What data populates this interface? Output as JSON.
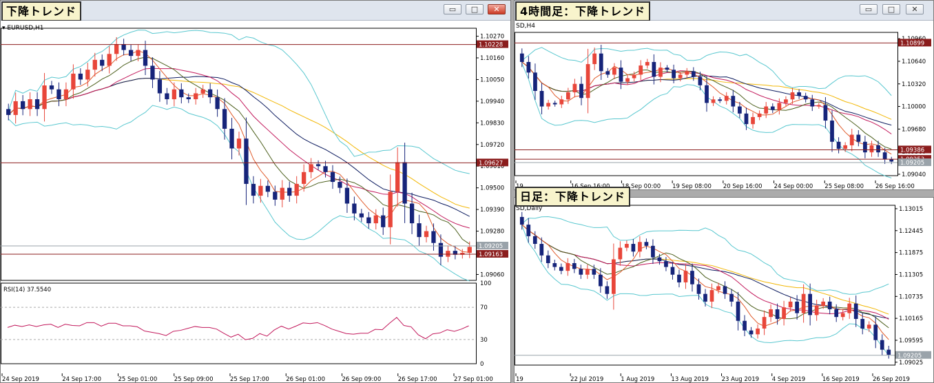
{
  "windows": {
    "h1": {
      "title": "下降トレンド",
      "symbol_label": "EURUSD,H1",
      "rsi_label": "RSI(14) 37.5540",
      "price_ticks": [
        "1.10270",
        "1.10160",
        "1.10050",
        "1.09940",
        "1.09830",
        "1.09720",
        "1.09610",
        "1.09500",
        "1.09390",
        "1.09280",
        "1.09170",
        "1.09060"
      ],
      "hlines": [
        {
          "label": "1.10228",
          "value": 1.10228,
          "color": "#8b1d1d"
        },
        {
          "label": "1.09627",
          "value": 1.09627,
          "color": "#8b1d1d"
        },
        {
          "label": "1.09163",
          "value": 1.09163,
          "color": "#8b1d1d"
        },
        {
          "label": "1.09205",
          "value": 1.09205,
          "color": "#9aa3aa"
        }
      ],
      "x_labels": [
        "24 Sep 2019",
        "24 Sep 17:00",
        "25 Sep 01:00",
        "25 Sep 09:00",
        "25 Sep 17:00",
        "26 Sep 01:00",
        "26 Sep 09:00",
        "26 Sep 17:00",
        "27 Sep 01:00"
      ],
      "rsi_ticks": [
        "100",
        "70",
        "30",
        "0"
      ],
      "chart_data": {
        "type": "candlestick",
        "ylim": [
          1.0903,
          1.103
        ],
        "series": [
          {
            "name": "close",
            "values": [
              1.0987,
              1.0994,
              1.099,
              1.0995,
              1.099,
              1.1002,
              1.1,
              1.0995,
              1.1,
              1.1008,
              1.1005,
              1.101,
              1.1015,
              1.1012,
              1.1018,
              1.1023,
              1.102,
              1.1017,
              1.102,
              1.1012,
              1.1005,
              1.0998,
              1.0995,
              1.1,
              1.0996,
              1.0995,
              1.0998,
              1.1,
              1.0996,
              1.099,
              1.098,
              1.097,
              1.0975,
              1.0952,
              1.0946,
              1.0951,
              1.0948,
              1.0944,
              1.095,
              1.0946,
              1.0952,
              1.0958,
              1.0962,
              1.0961,
              1.0958,
              1.0953,
              1.095,
              1.0942,
              1.0937,
              1.0935,
              1.0932,
              1.0936,
              1.093,
              1.0948,
              1.0963,
              1.0942,
              1.0932,
              1.0925,
              1.0928,
              1.0922,
              1.0915,
              1.0918,
              1.0916,
              1.0917,
              1.092
            ]
          },
          {
            "name": "open",
            "values": [
              1.099,
              1.0987,
              1.0994,
              1.099,
              1.0995,
              1.099,
              1.1002,
              1.1,
              1.0995,
              1.1,
              1.1008,
              1.1005,
              1.101,
              1.1015,
              1.1012,
              1.1018,
              1.1023,
              1.102,
              1.1017,
              1.102,
              1.1012,
              1.1005,
              1.0998,
              1.0995,
              1.1,
              1.0996,
              1.0995,
              1.0998,
              1.1,
              1.0996,
              1.099,
              1.098,
              1.097,
              1.0975,
              1.0952,
              1.0946,
              1.0951,
              1.0948,
              1.0944,
              1.095,
              1.0946,
              1.0952,
              1.0958,
              1.0962,
              1.0961,
              1.0958,
              1.0953,
              1.095,
              1.0942,
              1.0937,
              1.0935,
              1.0932,
              1.0936,
              1.093,
              1.0948,
              1.0963,
              1.0942,
              1.0932,
              1.0925,
              1.0928,
              1.0922,
              1.0915,
              1.0918,
              1.0916,
              1.0917
            ]
          }
        ]
      }
    },
    "h4": {
      "title": "4時間足：下降トレンド",
      "symbol_label": "SD,H4",
      "price_ticks": [
        "1.10960",
        "1.10640",
        "1.10320",
        "1.10000",
        "1.09680",
        "1.09360",
        "1.09040"
      ],
      "hlines": [
        {
          "label": "1.10899",
          "value": 1.10899,
          "color": "#8b1d1d"
        },
        {
          "label": "1.09386",
          "value": 1.09386,
          "color": "#8b1d1d"
        },
        {
          "label": "1.09253",
          "value": 1.09253,
          "color": "#8b1d1d"
        },
        {
          "label": "1.09205",
          "value": 1.09205,
          "color": "#9aa3aa"
        }
      ],
      "x_labels": [
        "19",
        "16 Sep 16:00",
        "18 Sep 00:00",
        "19 Sep 08:00",
        "20 Sep 16:00",
        "24 Sep 00:00",
        "25 Sep 08:00",
        "26 Sep 16:00"
      ]
    },
    "daily": {
      "title": "日足：下降トレンド",
      "symbol_label": "SD,Daily",
      "price_ticks": [
        "1.13015",
        "1.12445",
        "1.11875",
        "1.11305",
        "1.10735",
        "1.10165",
        "1.09595",
        "1.09025"
      ],
      "hlines": [
        {
          "label": "1.09205",
          "value": 1.09205,
          "color": "#9aa3aa"
        }
      ],
      "x_labels": [
        "19",
        "22 Jul 2019",
        "1 Aug 2019",
        "13 Aug 2019",
        "23 Aug 2019",
        "4 Sep 2019",
        "16 Sep 2019",
        "26 Sep 2019"
      ]
    }
  },
  "window_buttons": {
    "minimize": "▭",
    "maximize": "□",
    "close": "✕"
  },
  "colors": {
    "bull": "#e8463a",
    "bear": "#16247a",
    "ma_yellow": "#f2b705",
    "ma_navy": "#0b1a5e",
    "ma_pink": "#c2185b",
    "ma_olive": "#4c5f1c",
    "ma_orange": "#e05a2a",
    "bollinger": "#58c7cf",
    "rsi": "#c2185b",
    "level": "#8b1d1d"
  }
}
